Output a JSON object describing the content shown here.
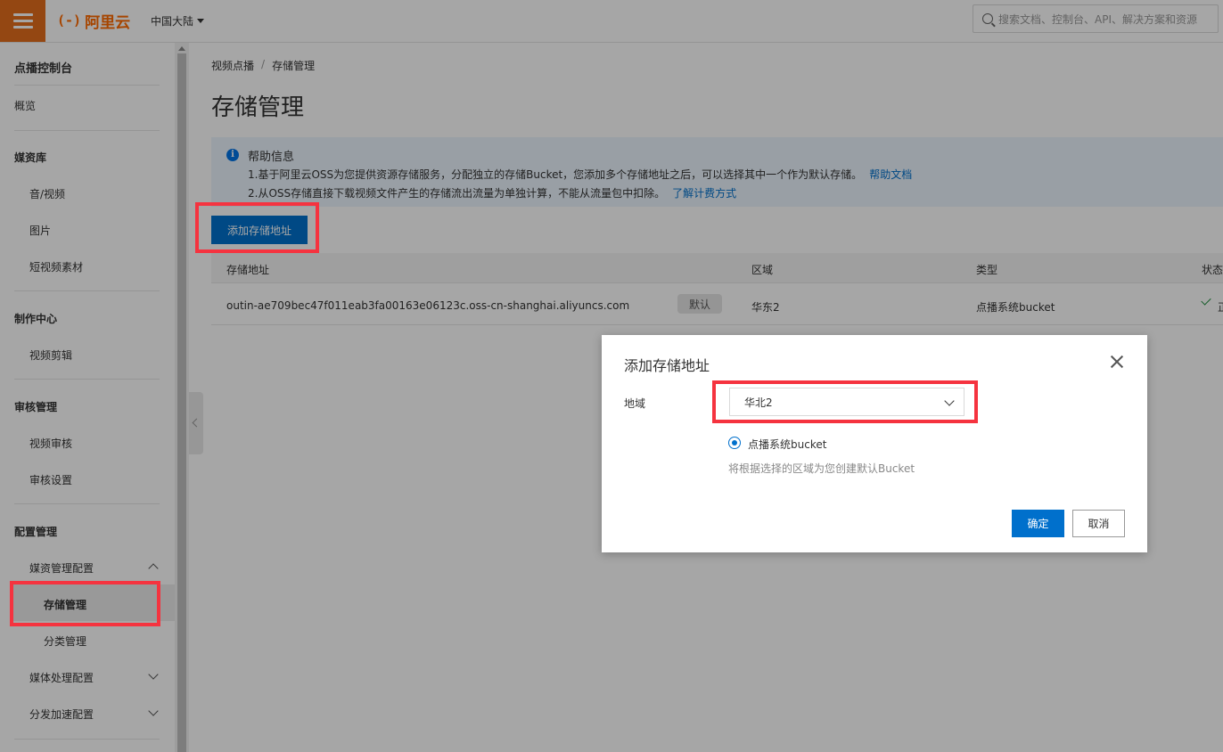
{
  "topbar": {
    "logo_text": "阿里云",
    "logo_mark": "(-)",
    "region": "中国大陆",
    "search_placeholder": "搜索文档、控制台、API、解决方案和资源"
  },
  "sidebar": {
    "title": "点播控制台",
    "overview": "概览",
    "groups": {
      "media": "媒资库",
      "media_av": "音/视频",
      "media_img": "图片",
      "media_short": "短视频素材",
      "prod": "制作中心",
      "prod_edit": "视频剪辑",
      "audit": "审核管理",
      "audit_video": "视频审核",
      "audit_settings": "审核设置",
      "config": "配置管理",
      "config_media": "媒资管理配置",
      "config_storage": "存储管理",
      "config_category": "分类管理",
      "config_processing": "媒体处理配置",
      "config_cdn": "分发加速配置"
    }
  },
  "main": {
    "breadcrumb": [
      "视频点播",
      "/",
      "存储管理"
    ],
    "title": "存储管理",
    "help": {
      "title": "帮助信息",
      "line1": "1.基于阿里云OSS为您提供资源存储服务，分配独立的存储Bucket，您添加多个存储地址之后，可以选择其中一个作为默认存储。",
      "line1_link": "帮助文档",
      "line2": "2.从OSS存储直接下载视频文件产生的存储流出流量为单独计算，不能从流量包中扣除。",
      "line2_link": "了解计费方式"
    },
    "add_button": "添加存储地址",
    "table": {
      "headers": [
        "存储地址",
        "区域",
        "类型",
        "状态"
      ],
      "rows": [
        {
          "address": "outin-ae709bec47f011eab3fa00163e06123c.oss-cn-shanghai.aliyuncs.com",
          "tag": "默认",
          "region": "华东2",
          "type": "点播系统bucket",
          "status": "正"
        }
      ]
    }
  },
  "dialog": {
    "title": "添加存储地址",
    "region_label": "地域",
    "region_value": "华北2",
    "radio_label": "点播系统bucket",
    "hint": "将根据选择的区域为您创建默认Bucket",
    "ok": "确定",
    "cancel": "取消"
  },
  "colors": {
    "brand": "#ff6a00",
    "primary": "#0070cc",
    "highlight": "#f5333f"
  }
}
